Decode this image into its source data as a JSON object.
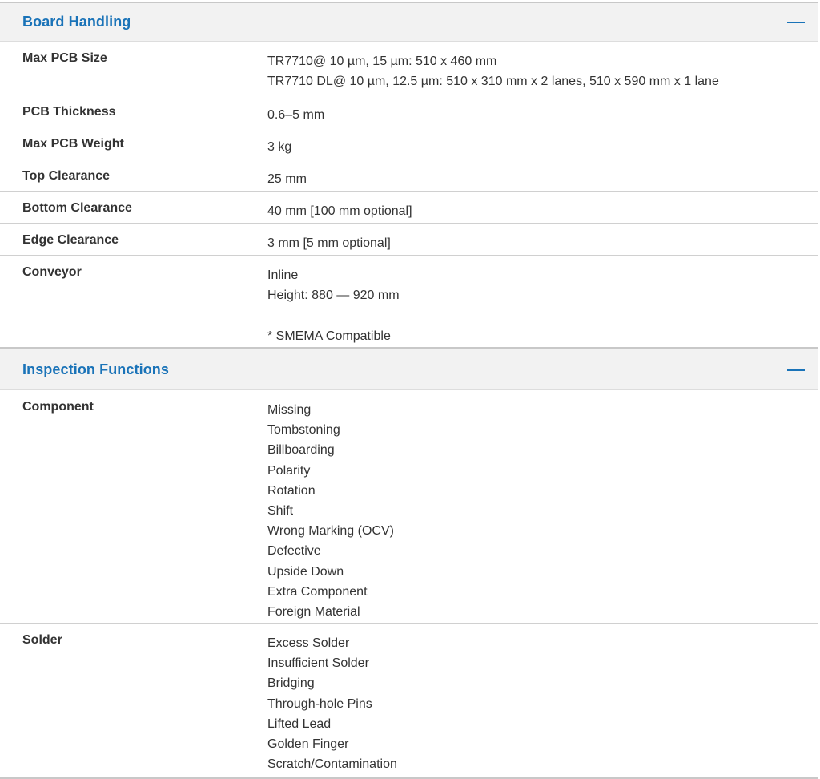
{
  "sections": [
    {
      "title": "Board Handling",
      "collapse_symbol": "—",
      "rows": [
        {
          "label": "Max PCB Size",
          "values": [
            "TR7710@ 10 µm, 15 µm: 510 x 460 mm",
            "TR7710 DL@ 10 µm, 12.5 µm: 510 x 310 mm x 2 lanes, 510 x 590 mm x 1 lane"
          ]
        },
        {
          "label": "PCB Thickness",
          "values": [
            "0.6–5 mm"
          ]
        },
        {
          "label": "Max PCB Weight",
          "values": [
            "3 kg"
          ]
        },
        {
          "label": "Top Clearance",
          "values": [
            "25 mm"
          ]
        },
        {
          "label": "Bottom Clearance",
          "values": [
            "40 mm [100 mm optional]"
          ]
        },
        {
          "label": "Edge Clearance",
          "values": [
            "3 mm [5 mm optional]"
          ]
        },
        {
          "label": "Conveyor",
          "values": [
            "Inline",
            "Height: 880 — 920 mm",
            "",
            "* SMEMA Compatible"
          ]
        }
      ]
    },
    {
      "title": "Inspection Functions",
      "collapse_symbol": "—",
      "rows": [
        {
          "label": "Component",
          "values": [
            "Missing",
            "Tombstoning",
            "Billboarding",
            "Polarity",
            "Rotation",
            "Shift",
            "Wrong Marking (OCV)",
            "Defective",
            "Upside Down",
            "Extra Component",
            "Foreign Material"
          ]
        },
        {
          "label": "Solder",
          "values": [
            "Excess Solder",
            "Insufficient Solder",
            "Bridging",
            "Through-hole Pins",
            "Lifted Lead",
            "Golden Finger",
            "Scratch/Contamination"
          ]
        }
      ]
    }
  ],
  "colors": {
    "accent": "#1a73b8",
    "header_bg": "#f2f2f2",
    "text": "#333333",
    "divider": "#d0d0d0"
  }
}
